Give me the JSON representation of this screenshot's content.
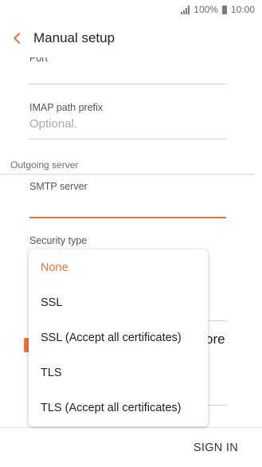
{
  "status_bar": {
    "battery": "100%",
    "time": "10:00"
  },
  "header": {
    "title": "Manual setup"
  },
  "fields": {
    "port_label": "Port",
    "imap_path_label": "IMAP path prefix",
    "imap_path_placeholder": "Optional.",
    "smtp_server_label": "SMTP server",
    "security_type_label": "Security type"
  },
  "section": {
    "outgoing_server": "Outgoing server"
  },
  "background_peek_text": "ore",
  "dropdown": {
    "options": [
      {
        "label": "None",
        "selected": true
      },
      {
        "label": "SSL",
        "selected": false
      },
      {
        "label": "SSL (Accept all certificates)",
        "selected": false
      },
      {
        "label": "TLS",
        "selected": false
      },
      {
        "label": "TLS (Accept all certificates)",
        "selected": false
      }
    ]
  },
  "bottom_bar": {
    "sign_in": "SIGN IN"
  },
  "colors": {
    "accent": "#e8743b"
  }
}
